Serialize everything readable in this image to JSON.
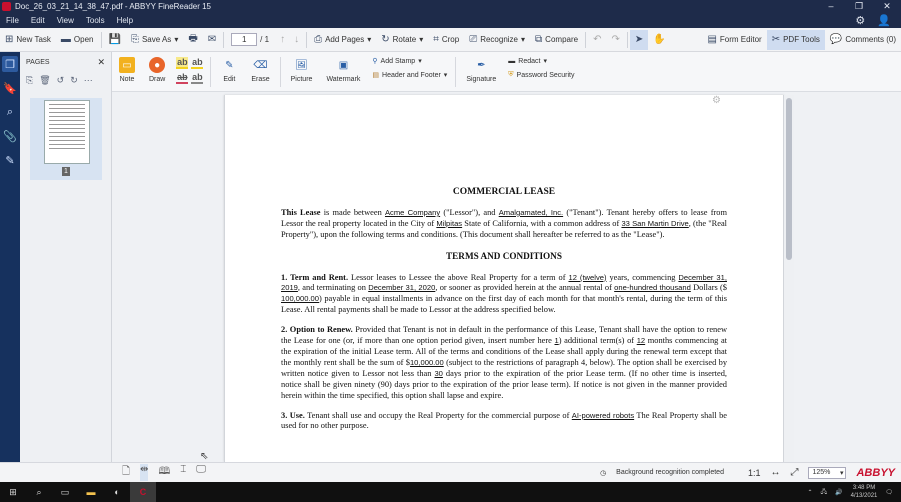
{
  "window": {
    "title": "Doc_26_03_21_14_38_47.pdf - ABBYY FineReader 15",
    "controls": [
      "–",
      "❐",
      "✕"
    ]
  },
  "menu": [
    "File",
    "Edit",
    "View",
    "Tools",
    "Help"
  ],
  "toolbar": {
    "new_task": "New Task",
    "open": "Open",
    "save_as": "Save As",
    "page_current": "1",
    "page_total": "/ 1",
    "add_pages": "Add Pages",
    "rotate": "Rotate",
    "crop": "Crop",
    "recognize": "Recognize",
    "compare": "Compare",
    "form_editor": "Form Editor",
    "pdf_tools": "PDF Tools",
    "comments": "Comments (0)"
  },
  "pages_panel": {
    "title": "PAGES",
    "page_number": "1"
  },
  "ribbon": {
    "note": "Note",
    "draw": "Draw",
    "edit": "Edit",
    "erase": "Erase",
    "picture": "Picture",
    "watermark": "Watermark",
    "add_stamp": "Add Stamp",
    "header_footer": "Header and Footer",
    "signature": "Signature",
    "redact": "Redact",
    "password_security": "Password Security",
    "ab": "ab"
  },
  "document": {
    "title": "COMMERCIAL LEASE",
    "p1": [
      "This Lease",
      " is made between ",
      "Acme Company",
      " (\"Lessor\"), and ",
      "Amalgamated, Inc.",
      " (\"Tenant\"). Tenant hereby offers to lease from Lessor the real property located in the City of ",
      "Milpitas",
      " State of California, with a common address of ",
      "33 San Martin Drive",
      ", (the \"Real Property\"), upon the following terms and conditions. (This document shall hereafter be referred to as the \"Lease\")."
    ],
    "subtitle": "TERMS AND CONDITIONS",
    "s1": [
      "1. Term and Rent.",
      " Lessor leases to Lessee the above Real Property for a term of ",
      "12 (twelve)",
      " years, commencing ",
      "December 31, 2019",
      ", and terminating on ",
      "December 31, 2020",
      ", or sooner as provided herein at the annual rental of ",
      "one-hundred thousand",
      " Dollars ($ ",
      "100,000.00",
      ") payable in equal installments in advance on the first day of each month for that month's rental, during the term of this Lease. All rental payments shall be made to Lessor at the address specified below."
    ],
    "s2": [
      "2. Option to Renew.",
      " Provided that Tenant is not in default in the performance of this Lease, Tenant shall have the option to renew the Lease for one (or, if more than one option period given, insert number here ",
      "1",
      ") additional term(s) of ",
      "12",
      " months commencing at the expiration of the initial Lease term. All of the terms and conditions of the Lease shall apply during the renewal term except that the monthly rent shall be the sum of $",
      "10,000.00",
      " (subject to the restrictions of paragraph 4, below). The option shall be exercised by written notice given to Lessor not less than ",
      "30",
      " days prior to the expiration of the prior Lease term. (If no other time is inserted, notice shall be given ninety (90) days prior to the expiration of the prior lease term). If notice is not given in the manner provided herein within the time specified, this option shall lapse and expire."
    ],
    "s3": [
      "3. Use.",
      " Tenant shall use and occupy the Real Property for the commercial purpose of ",
      "AI-powered robots",
      " The Real Property shall be used for no other purpose."
    ]
  },
  "status": {
    "recognition": "Background recognition completed",
    "ratio": "1:1",
    "zoom": "125%",
    "brand": "ABBYY"
  },
  "taskbar": {
    "time": "3:48 PM",
    "date": "4/13/2021"
  }
}
